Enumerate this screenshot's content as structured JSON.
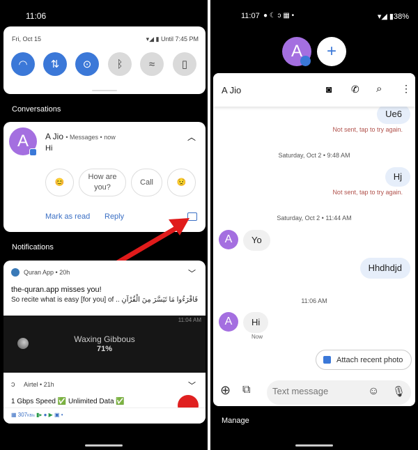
{
  "left": {
    "status_time": "11:06",
    "quick_settings": {
      "date": "Fri, Oct 15",
      "battery_text": "Until 7:45 PM",
      "tiles": [
        {
          "icon": "wifi-icon",
          "on": true
        },
        {
          "icon": "data-icon",
          "on": true
        },
        {
          "icon": "location-icon",
          "on": true
        },
        {
          "icon": "bluetooth-icon",
          "on": false
        },
        {
          "icon": "auto-rotate-icon",
          "on": false
        },
        {
          "icon": "flashlight-icon",
          "on": false
        }
      ]
    },
    "conversations_header": "Conversations",
    "conversation": {
      "avatar_letter": "A",
      "name": "A Jio",
      "app": "Messages",
      "time": "now",
      "message": "Hi",
      "smart_replies": [
        "😊",
        "How are you?",
        "Call",
        "😟"
      ],
      "actions": {
        "mark_read": "Mark as read",
        "reply": "Reply"
      }
    },
    "notifications_header": "Notifications",
    "quran": {
      "app": "Quran App",
      "time": "20h",
      "title": "the-quran.app misses you!",
      "body": "So recite what is easy [for you] of .. فَاقْرَءُوا مَا تَيَسَّرَ مِنَ الْقُرْآنِ"
    },
    "moon": {
      "time": "11:04 AM",
      "phase": "Waxing Gibbous",
      "percent": "71%"
    },
    "airtel": {
      "app": "Airtel",
      "time": "21h",
      "body": "1 Gbps Speed ✅ Unlimited Data ✅",
      "speed": "307",
      "speed_unit": "KB/s"
    }
  },
  "right": {
    "status_time": "11:07",
    "battery": "38%",
    "bubble_avatar_letter": "A",
    "chat": {
      "name": "A Jio",
      "messages": [
        {
          "type": "out",
          "text": "Ue6",
          "error": "Not sent, tap to try again."
        },
        {
          "type": "stamp",
          "text": "Saturday, Oct 2 • 9:48 AM"
        },
        {
          "type": "out",
          "text": "Hj",
          "error": "Not sent, tap to try again."
        },
        {
          "type": "stamp",
          "text": "Saturday, Oct 2 • 11:44 AM"
        },
        {
          "type": "in",
          "text": "Yo"
        },
        {
          "type": "out",
          "text": "Hhdhdjd"
        },
        {
          "type": "stamp",
          "text": "11:06 AM"
        },
        {
          "type": "in",
          "text": "Hi",
          "meta": "Now"
        }
      ],
      "attach_label": "Attach recent photo",
      "input_placeholder": "Text message"
    },
    "manage_label": "Manage"
  },
  "colors": {
    "accent": "#3b78d8",
    "avatar": "#a46fe0",
    "error": "#b0504a",
    "arrow": "#e01b1b"
  }
}
